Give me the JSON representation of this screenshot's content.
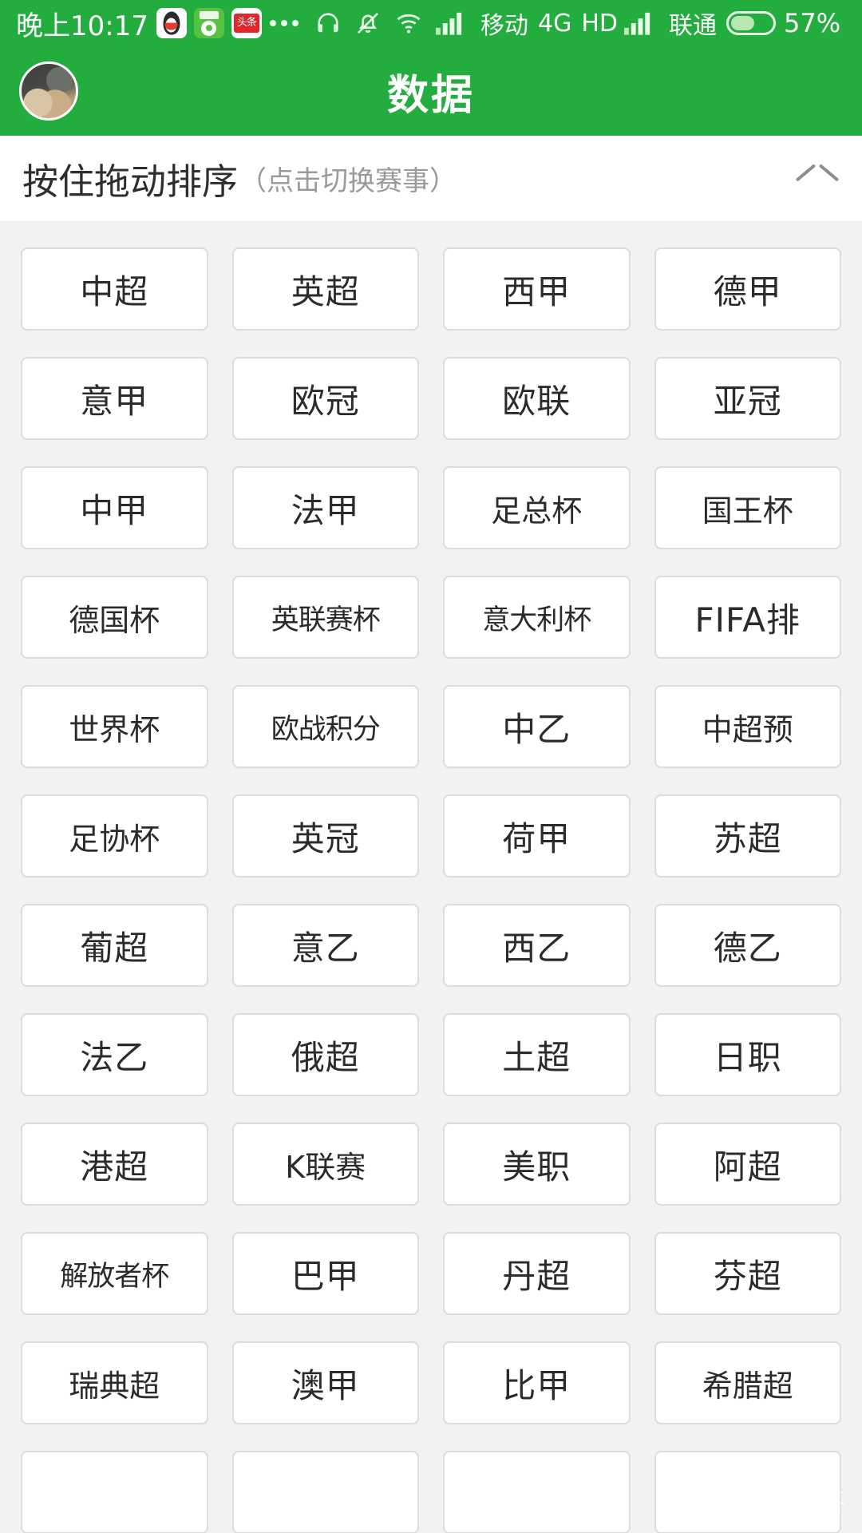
{
  "status_bar": {
    "time": "晚上10:17",
    "app_icons": [
      "qq-icon",
      "football-app-icon",
      "toutiao-icon"
    ],
    "toutiao_label": "头条",
    "overflow_dots": "...",
    "indicator_icons": [
      "headset-icon",
      "bell-muted-icon",
      "wifi-icon",
      "signal-icon"
    ],
    "carrier_primary": "移动",
    "network_type": "4G",
    "hd_label": "HD",
    "carrier_secondary": "联通",
    "battery_percent": "57%",
    "battery_level": 57,
    "background_color": "#23ad3f",
    "foreground_color": "#ffffff"
  },
  "app_bar": {
    "title": "数据",
    "avatar": "user-avatar",
    "background_color": "#23ad3f"
  },
  "sort_bar": {
    "main_label": "按住拖动排序",
    "hint_label": "（点击切换赛事）",
    "collapse_icon": "chevron-up-icon"
  },
  "grid": {
    "columns": 4,
    "tiles": [
      "中超",
      "英超",
      "西甲",
      "德甲",
      "意甲",
      "欧冠",
      "欧联",
      "亚冠",
      "中甲",
      "法甲",
      "足总杯",
      "国王杯",
      "德国杯",
      "英联赛杯",
      "意大利杯",
      "FIFA排",
      "世界杯",
      "欧战积分",
      "中乙",
      "中超预",
      "足协杯",
      "英冠",
      "荷甲",
      "苏超",
      "葡超",
      "意乙",
      "西乙",
      "德乙",
      "法乙",
      "俄超",
      "土超",
      "日职",
      "港超",
      "K联赛",
      "美职",
      "阿超",
      "解放者杯",
      "巴甲",
      "丹超",
      "芬超",
      "瑞典超",
      "澳甲",
      "比甲",
      "希腊超",
      "",
      "",
      "",
      ""
    ]
  },
  "watermark": {
    "text": "悟空问答",
    "logo": "wukong-logo"
  },
  "colors": {
    "brand_green": "#23ad3f",
    "page_background": "#f2f2f2",
    "tile_background": "#ffffff",
    "tile_border": "#dcdcdc",
    "text_primary": "#2b2b2b",
    "text_muted": "#9a9a9a"
  }
}
